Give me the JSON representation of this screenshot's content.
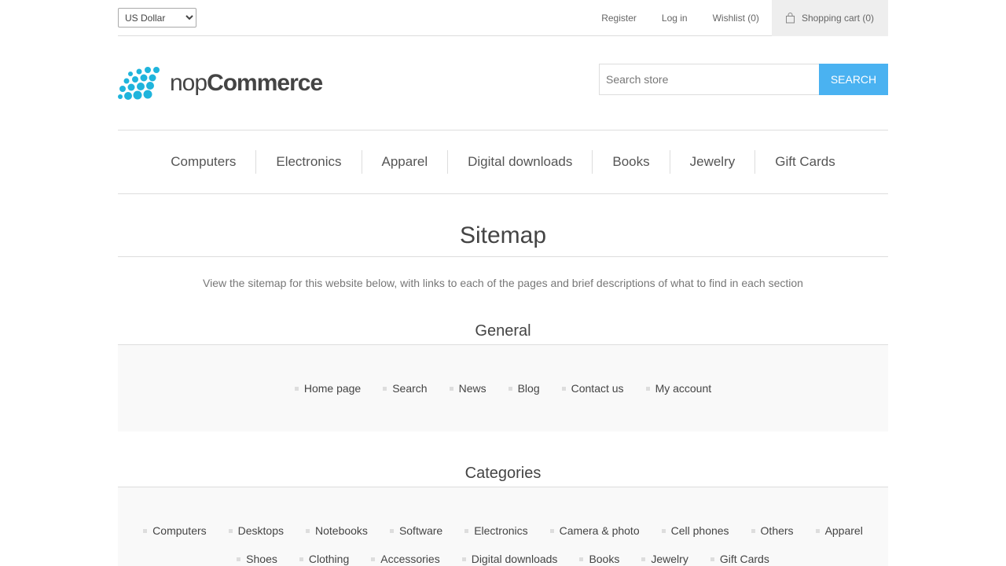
{
  "header": {
    "currency": "US Dollar",
    "links": {
      "register": "Register",
      "login": "Log in",
      "wishlist": "Wishlist (0)",
      "cart": "Shopping cart (0)"
    }
  },
  "logo": {
    "light": "nop",
    "bold": "Commerce"
  },
  "search": {
    "placeholder": "Search store",
    "button": "SEARCH"
  },
  "menu": [
    "Computers",
    "Electronics",
    "Apparel",
    "Digital downloads",
    "Books",
    "Jewelry",
    "Gift Cards"
  ],
  "page": {
    "title": "Sitemap",
    "description": "View the sitemap for this website below, with links to each of the pages and brief descriptions of what to find in each section"
  },
  "general": {
    "title": "General",
    "links": [
      "Home page",
      "Search",
      "News",
      "Blog",
      "Contact us",
      "My account"
    ]
  },
  "categories": {
    "title": "Categories",
    "links": [
      "Computers",
      "Desktops",
      "Notebooks",
      "Software",
      "Electronics",
      "Camera & photo",
      "Cell phones",
      "Others",
      "Apparel",
      "Shoes",
      "Clothing",
      "Accessories",
      "Digital downloads",
      "Books",
      "Jewelry",
      "Gift Cards"
    ]
  },
  "colors": {
    "accent": "#4ab2f1",
    "logo": "#1fb4dc"
  }
}
